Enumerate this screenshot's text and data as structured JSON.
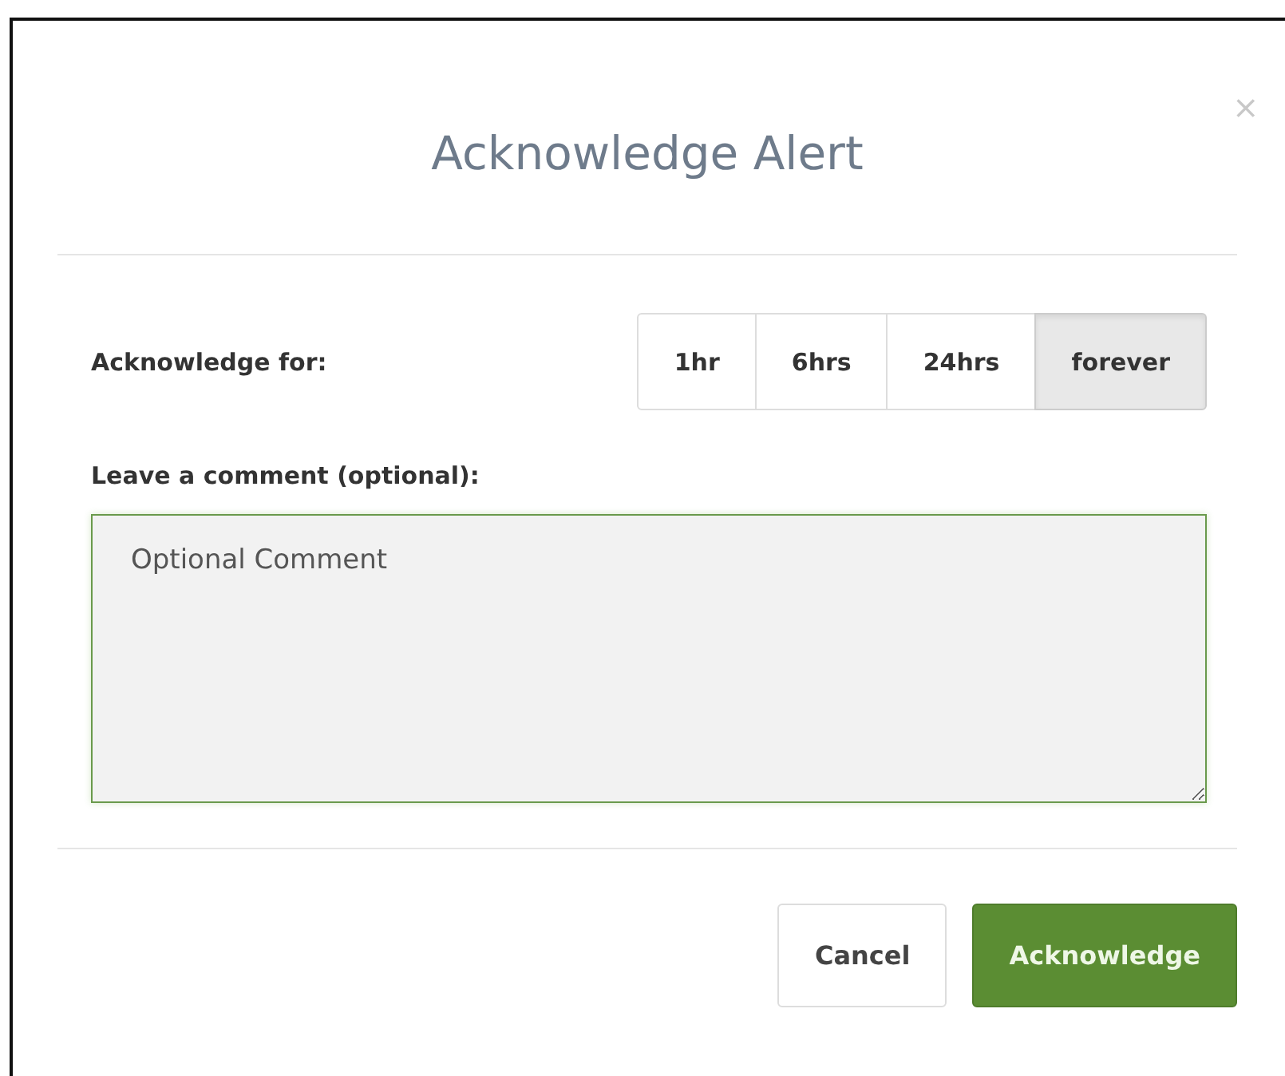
{
  "dialog": {
    "title": "Acknowledge Alert",
    "close": "×"
  },
  "duration": {
    "label": "Acknowledge for:",
    "options": [
      {
        "label": "1hr",
        "selected": false
      },
      {
        "label": "6hrs",
        "selected": false
      },
      {
        "label": "24hrs",
        "selected": false
      },
      {
        "label": "forever",
        "selected": true
      }
    ]
  },
  "comment": {
    "label": "Leave a comment (optional):",
    "value": "Optional Comment"
  },
  "buttons": [
    {
      "label": "Cancel",
      "kind": "default"
    },
    {
      "label": "Acknowledge",
      "kind": "primary"
    }
  ]
}
